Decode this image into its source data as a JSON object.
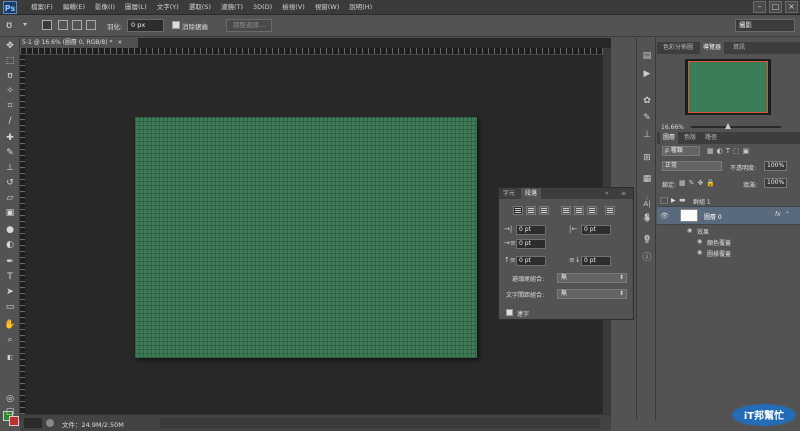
{
  "app": {
    "logo": "Ps"
  },
  "menu": [
    "檔案(F)",
    "編輯(E)",
    "影像(I)",
    "圖層(L)",
    "文字(Y)",
    "選取(S)",
    "濾鏡(T)",
    "3D(D)",
    "檢視(V)",
    "視窗(W)",
    "說明(H)"
  ],
  "window_controls": {
    "minimize": "–",
    "restore": "□",
    "close": "×"
  },
  "options_bar": {
    "feather_label": "羽化:",
    "feather_value": "0 px",
    "antialias_label": "消除鋸齒",
    "refine_button": "調整邊緣...",
    "workspace": "攝影"
  },
  "document": {
    "tab_title": "5-1 @ 16.6% (圖層 0, RGB/8) *",
    "tab_close": "×",
    "canvas_color": "#3b7d57"
  },
  "status_bar": {
    "zoom": "16.66%",
    "doc_info": "文件：24.9M/2.50M"
  },
  "paragraph_panel": {
    "tabs": [
      "字元",
      "段落"
    ],
    "fields": [
      {
        "icon": "→|",
        "value": "0 pt"
      },
      {
        "icon": "|←",
        "value": "0 pt"
      },
      {
        "icon": "→≡",
        "value": "0 pt"
      },
      {
        "icon": "↑≡",
        "value": "0 pt"
      },
      {
        "icon": "≡↓",
        "value": "0 pt"
      }
    ],
    "rows": [
      {
        "label": "避頭尾組合:",
        "value": "無"
      },
      {
        "label": "文字間距組合:",
        "value": "無"
      }
    ],
    "hyphenate_label": "連字"
  },
  "navigator_panel": {
    "tabs": [
      "色彩分佈圖",
      "導覽器",
      "資訊"
    ],
    "zoom": "16.66%",
    "thumb_border": "#d9533b"
  },
  "layers_panel": {
    "tabs": [
      "圖層",
      "色版",
      "路徑"
    ],
    "filter_type": "ρ 種類",
    "blend_mode": "正常",
    "opacity_label": "不透明度:",
    "opacity_value": "100%",
    "lock_label": "鎖定:",
    "fill_label": "填滿:",
    "fill_value": "100%",
    "layers": [
      {
        "name": "群組 1",
        "type": "group"
      },
      {
        "name": "圖層 0",
        "type": "layer",
        "fx": "fx"
      }
    ],
    "effects_label": "效果",
    "effects": [
      "顏色覆蓋",
      "圖樣覆蓋"
    ]
  },
  "watermark": {
    "text": "iT邦幫忙"
  }
}
